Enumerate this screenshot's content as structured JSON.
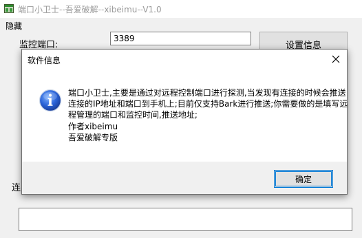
{
  "window": {
    "title": "端口小卫士--吾爱破解--xibeimu--V1.0",
    "menu": [
      "隐藏"
    ]
  },
  "form": {
    "port_label": "监控端口:",
    "port_value": "3389",
    "settings_button": "设置信息",
    "connection_label": "连",
    "log_value": ""
  },
  "dialog": {
    "title": "软件信息",
    "message_lines": [
      "端口小卫士,主要是通过对远程控制端口进行探测,当发现有连接的时候会推送",
      "连接的IP地址和端口到手机上;目前仅支持Bark进行推送;你需要做的是填写远",
      "程管理的端口和监控时间,推送地址;",
      "作者xibeimu",
      "吾爱破解专版"
    ],
    "ok_button": "确定"
  },
  "icons": {
    "app": "app-window-icon",
    "info": "info-icon",
    "close": "close-icon"
  },
  "colors": {
    "info_icon": "#1e5bd8",
    "focus_border": "#0078d7",
    "title_inactive": "#9a9a9a"
  }
}
